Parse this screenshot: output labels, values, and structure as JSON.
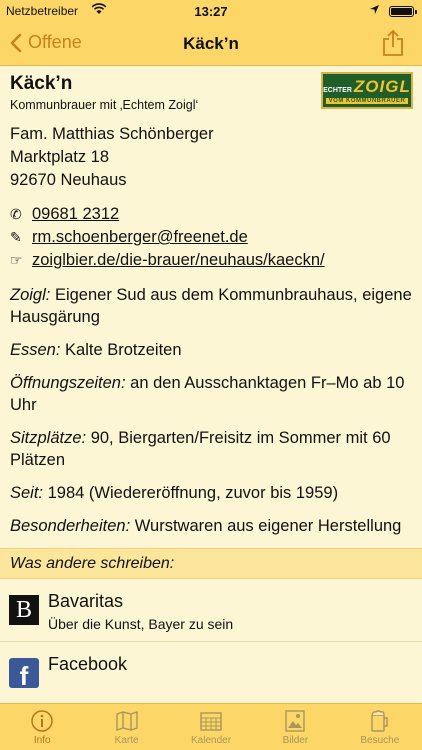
{
  "status": {
    "carrier": "Netzbetreiber",
    "time": "13:27",
    "battery_level": 1.0
  },
  "nav": {
    "back_label": "Offene",
    "title": "Käck’n"
  },
  "header": {
    "name": "Käck’n",
    "subtitle": "Kommunbrauer mit ‚Echtem Zoigl‘"
  },
  "logo": {
    "small": "ECHTER",
    "big": "ZOIGL",
    "bottom": "VOM KOMMUNBRAUER"
  },
  "address": {
    "line1": "Fam. Matthias Schönberger",
    "line2": "Marktplatz 18",
    "line3": "92670 Neuhaus"
  },
  "contact": {
    "phone_icon": "✆",
    "phone": "09681 2312",
    "email_icon": "✎",
    "email": "rm.schoenberger@freenet.de",
    "web_icon": "☞",
    "web": "zoiglbier.de/die-brauer/neuhaus/kaeckn/"
  },
  "info": {
    "zoigl_label": "Zoigl:",
    "zoigl_value": " Eigener Sud aus dem Kommunbrauhaus, eigene Hausgärung",
    "essen_label": "Essen:",
    "essen_value": " Kalte Brotzeiten",
    "oeff_label": "Öffnungszeiten:",
    "oeff_value": " an den Ausschanktagen Fr–Mo ab 10 Uhr",
    "sitz_label": "Sitzplätze:",
    "sitz_value": " 90, Biergarten/Freisitz im Sommer mit 60 Plätzen",
    "seit_label": "Seit:",
    "seit_value": " 1984 (Wiedereröffnung, zuvor bis 1959)",
    "bes_label": "Besonderheiten:",
    "bes_value": " Wurstwaren aus eigener Herstellung"
  },
  "section_title": "Was andere schreiben:",
  "reviews": [
    {
      "icon_letter": "B",
      "title": "Bavaritas",
      "desc": "Über die Kunst, Bayer zu sein"
    },
    {
      "icon_letter": "f",
      "title": "Facebook",
      "desc": ""
    }
  ],
  "tabs": [
    {
      "label": "Info",
      "icon": "info-icon",
      "active": true
    },
    {
      "label": "Karte",
      "icon": "map-icon"
    },
    {
      "label": "Kalender",
      "icon": "calendar-icon"
    },
    {
      "label": "Bilder",
      "icon": "image-icon"
    },
    {
      "label": "Besuche",
      "icon": "beer-mug-icon"
    }
  ],
  "colors": {
    "bar": "#fcd667",
    "accent": "#c7831a",
    "background": "#fdf6d4",
    "section": "#fbe69b"
  }
}
